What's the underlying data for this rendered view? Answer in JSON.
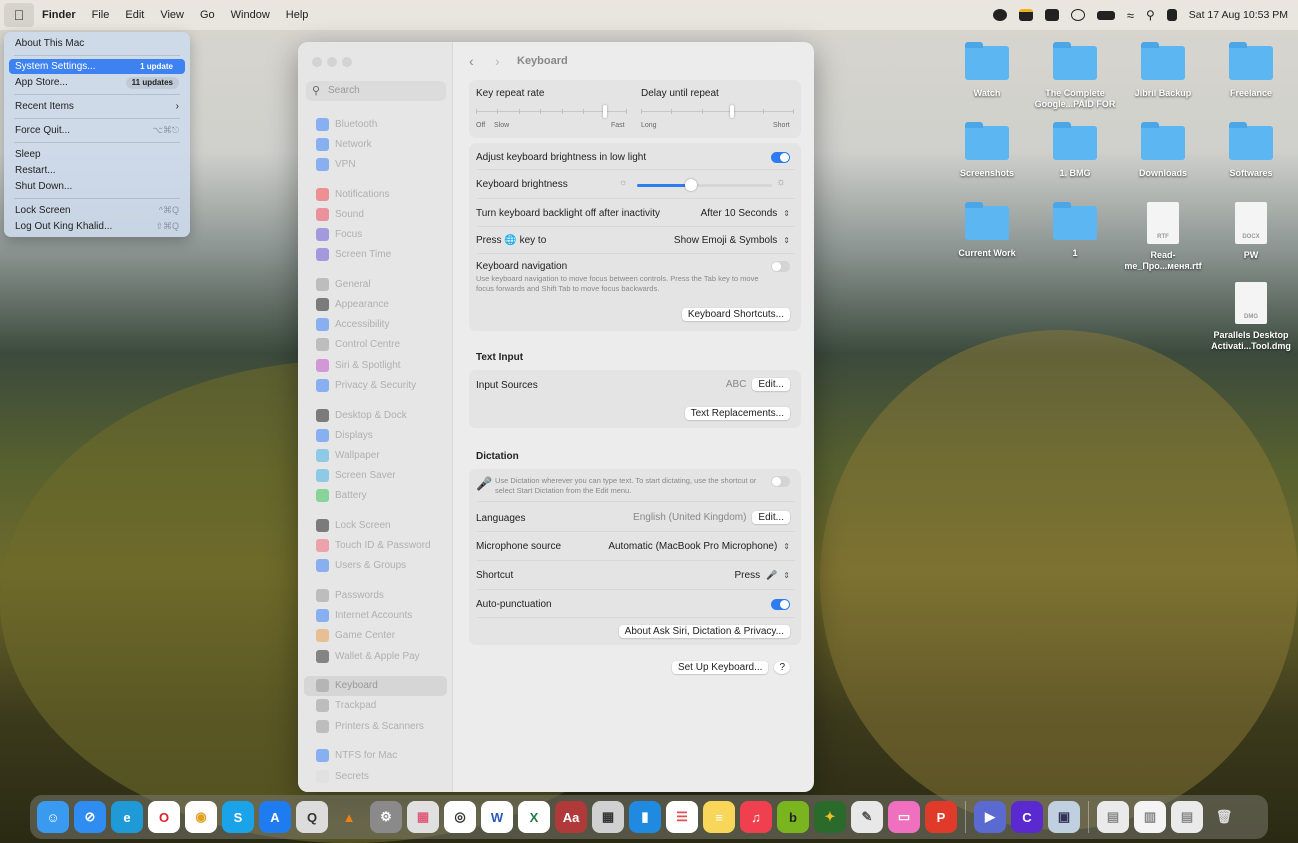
{
  "menubar": {
    "app": "Finder",
    "items": [
      "File",
      "Edit",
      "View",
      "Go",
      "Window",
      "Help"
    ],
    "datetime": "Sat 17 Aug  10:53 PM",
    "status_icons": [
      "grammarly-icon",
      "notification-icon",
      "bartender-icon",
      "user-icon",
      "battery-icon",
      "wifi-icon",
      "search-icon",
      "control-centre-icon"
    ]
  },
  "apple_menu": {
    "about": "About This Mac",
    "system_settings": "System Settings...",
    "system_settings_badge": "1 update",
    "app_store": "App Store...",
    "app_store_badge": "11 updates",
    "recent_items": "Recent Items",
    "force_quit": "Force Quit...",
    "force_quit_shortcut": "⌥⌘⎋",
    "sleep": "Sleep",
    "restart": "Restart...",
    "shut_down": "Shut Down...",
    "lock_screen": "Lock Screen",
    "lock_screen_shortcut": "^⌘Q",
    "log_out": "Log Out King Khalid...",
    "log_out_shortcut": "⇧⌘Q"
  },
  "settings": {
    "search_placeholder": "Search",
    "sidebar_groups": [
      [
        {
          "label": "Bluetooth",
          "color": "#3a82f6"
        },
        {
          "label": "Network",
          "color": "#3a82f6"
        },
        {
          "label": "VPN",
          "color": "#3a82f6"
        }
      ],
      [
        {
          "label": "Notifications",
          "color": "#ee4b4b"
        },
        {
          "label": "Sound",
          "color": "#ee4b5e"
        },
        {
          "label": "Focus",
          "color": "#6b5bd6"
        },
        {
          "label": "Screen Time",
          "color": "#6b5bd6"
        }
      ],
      [
        {
          "label": "General",
          "color": "#9b9b9b"
        },
        {
          "label": "Appearance",
          "color": "#222222"
        },
        {
          "label": "Accessibility",
          "color": "#3a82f6"
        },
        {
          "label": "Control Centre",
          "color": "#9b9b9b"
        },
        {
          "label": "Siri & Spotlight",
          "color": "#c055c8"
        },
        {
          "label": "Privacy & Security",
          "color": "#3a82f6"
        }
      ],
      [
        {
          "label": "Desktop & Dock",
          "color": "#222222"
        },
        {
          "label": "Displays",
          "color": "#3a82f6"
        },
        {
          "label": "Wallpaper",
          "color": "#45b0e6"
        },
        {
          "label": "Screen Saver",
          "color": "#45b0e6"
        },
        {
          "label": "Battery",
          "color": "#38c257"
        }
      ],
      [
        {
          "label": "Lock Screen",
          "color": "#222222"
        },
        {
          "label": "Touch ID & Password",
          "color": "#ee6a7a"
        },
        {
          "label": "Users & Groups",
          "color": "#3a82f6"
        }
      ],
      [
        {
          "label": "Passwords",
          "color": "#9b9b9b"
        },
        {
          "label": "Internet Accounts",
          "color": "#3a82f6"
        },
        {
          "label": "Game Center",
          "color": "#e6a050"
        },
        {
          "label": "Wallet & Apple Pay",
          "color": "#333333"
        }
      ],
      [
        {
          "label": "Keyboard",
          "color": "#9b9b9b",
          "selected": true
        },
        {
          "label": "Trackpad",
          "color": "#9b9b9b"
        },
        {
          "label": "Printers & Scanners",
          "color": "#9b9b9b"
        }
      ],
      [
        {
          "label": "NTFS for Mac",
          "color": "#3a82f6"
        },
        {
          "label": "Secrets",
          "color": "#dddddd"
        }
      ]
    ],
    "title": "Keyboard",
    "key_repeat_rate": {
      "label": "Key repeat rate",
      "min_off": "Off",
      "min": "Slow",
      "max": "Fast",
      "value_fraction": 0.86
    },
    "delay_until_repeat": {
      "label": "Delay until repeat",
      "min": "Long",
      "max": "Short",
      "value_fraction": 0.6
    },
    "adjust_brightness": {
      "label": "Adjust keyboard brightness in low light",
      "on": true
    },
    "keyboard_brightness": {
      "label": "Keyboard brightness",
      "value_fraction": 0.4
    },
    "backlight_off": {
      "label": "Turn keyboard backlight off after inactivity",
      "value": "After 10 Seconds"
    },
    "press_key": {
      "label_pre": "Press",
      "label_post": "key to",
      "value": "Show Emoji & Symbols"
    },
    "keyboard_navigation": {
      "label": "Keyboard navigation",
      "description": "Use keyboard navigation to move focus between controls. Press the Tab key to move focus forwards and Shift Tab to move focus backwards.",
      "on": false
    },
    "keyboard_shortcuts_button": "Keyboard Shortcuts...",
    "text_input": {
      "header": "Text Input",
      "input_sources_label": "Input Sources",
      "input_sources_value": "ABC",
      "edit_button": "Edit...",
      "text_replacements_button": "Text Replacements..."
    },
    "dictation": {
      "header": "Dictation",
      "description": "Use Dictation wherever you can type text. To start dictating, use the shortcut or select Start Dictation from the Edit menu.",
      "on": false,
      "languages_label": "Languages",
      "languages_value": "English (United Kingdom)",
      "edit_button": "Edit...",
      "mic_label": "Microphone source",
      "mic_value": "Automatic (MacBook Pro Microphone)",
      "shortcut_label": "Shortcut",
      "shortcut_value": "Press",
      "autopunct_label": "Auto-punctuation",
      "autopunct_on": true,
      "about_button": "About Ask Siri, Dictation & Privacy..."
    },
    "setup_button": "Set Up Keyboard...",
    "help_button": "?",
    "accent": "#2f7bf0"
  },
  "desktop": [
    {
      "label": "Watch",
      "type": "folder"
    },
    {
      "label": "The Complete Google...PAID FOR",
      "type": "folder"
    },
    {
      "label": "Jibril Backup",
      "type": "folder"
    },
    {
      "label": "Freelance",
      "type": "folder"
    },
    {
      "label": "Screenshots",
      "type": "folder"
    },
    {
      "label": "1. BMG",
      "type": "folder"
    },
    {
      "label": "Downloads",
      "type": "folder"
    },
    {
      "label": "Softwares",
      "type": "folder"
    },
    {
      "label": "Current Work",
      "type": "folder"
    },
    {
      "label": "1",
      "type": "folder"
    },
    {
      "label": "Read-me_Про...меня.rtf",
      "type": "file",
      "tag": "RTF"
    },
    {
      "label": "PW",
      "type": "file",
      "tag": "DOCX"
    },
    {
      "label": "Parallels Desktop Activati...Tool.dmg",
      "type": "file",
      "tag": "DMG"
    }
  ],
  "dock": [
    {
      "name": "finder",
      "color": "#3a9af0",
      "g": "☺"
    },
    {
      "name": "safari",
      "color": "#2f8cf0",
      "g": "⊘"
    },
    {
      "name": "edge",
      "color": "#1f9ad6",
      "g": "e"
    },
    {
      "name": "opera",
      "color": "#ffffff",
      "g": "O",
      "fg": "#e0202a"
    },
    {
      "name": "chrome",
      "color": "#ffffff",
      "g": "◉",
      "fg": "#e0a020"
    },
    {
      "name": "skype",
      "color": "#1aa3e8",
      "g": "S"
    },
    {
      "name": "app-store",
      "color": "#1f7cf0",
      "g": "A"
    },
    {
      "name": "quicktime",
      "color": "#dcdcdc",
      "g": "Q",
      "fg": "#333"
    },
    {
      "name": "vlc",
      "color": "transparent",
      "g": "▲",
      "fg": "#f08010"
    },
    {
      "name": "system-settings",
      "color": "#8a8a8a",
      "g": "⚙"
    },
    {
      "name": "launchpad",
      "color": "#e0e0e0",
      "g": "▦",
      "fg": "#e05a7a"
    },
    {
      "name": "screenshot",
      "color": "#ffffff",
      "g": "◎",
      "fg": "#333"
    },
    {
      "name": "word",
      "color": "#ffffff",
      "g": "W",
      "fg": "#2b5bb8"
    },
    {
      "name": "excel",
      "color": "#ffffff",
      "g": "X",
      "fg": "#1f7a44"
    },
    {
      "name": "dictionary",
      "color": "#b03a3a",
      "g": "Aa"
    },
    {
      "name": "calculator",
      "color": "#d0d0d0",
      "g": "▦",
      "fg": "#333"
    },
    {
      "name": "app-blue",
      "color": "#1f8ae0",
      "g": "▮"
    },
    {
      "name": "reminders",
      "color": "#ffffff",
      "g": "☰",
      "fg": "#e05050"
    },
    {
      "name": "notes",
      "color": "#f7d65a",
      "g": "≡",
      "fg": "#fff"
    },
    {
      "name": "music",
      "color": "#f04050",
      "g": "♫"
    },
    {
      "name": "bartender",
      "color": "#7ab520",
      "g": "b",
      "fg": "#222"
    },
    {
      "name": "maps-app",
      "color": "#2a6a2a",
      "g": "✦",
      "fg": "#f0c020"
    },
    {
      "name": "preview",
      "color": "#e8e8e8",
      "g": "✎",
      "fg": "#555"
    },
    {
      "name": "cleanmymac",
      "color": "#f070c0",
      "g": "▭"
    },
    {
      "name": "papers",
      "color": "#e03a2a",
      "g": "P"
    },
    {
      "name": "sep"
    },
    {
      "name": "parallels",
      "color": "#5a6ad0",
      "g": "▶"
    },
    {
      "name": "notchmeister",
      "color": "#5a2ad0",
      "g": "C"
    },
    {
      "name": "image-viewer",
      "color": "#c0d0e0",
      "g": "▣",
      "fg": "#335"
    },
    {
      "name": "sep"
    },
    {
      "name": "window-1",
      "color": "#eaeaea",
      "g": "▤",
      "fg": "#888"
    },
    {
      "name": "window-2",
      "color": "#f4f4f4",
      "g": "▥",
      "fg": "#888"
    },
    {
      "name": "window-3",
      "color": "#eaeaea",
      "g": "▤",
      "fg": "#888"
    },
    {
      "name": "trash",
      "color": "transparent",
      "g": "🗑",
      "fg": "#ddd"
    }
  ]
}
